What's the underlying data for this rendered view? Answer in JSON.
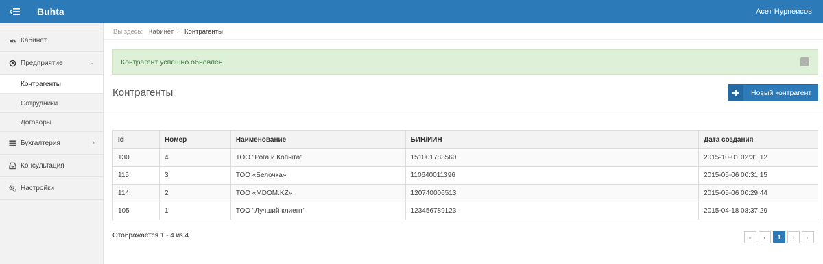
{
  "app": {
    "brand": "Buhta",
    "user": "Асет Нурпеисов"
  },
  "sidebar": {
    "items": [
      {
        "label": "Кабинет",
        "icon": "dashboard-icon"
      },
      {
        "label": "Предприятие",
        "icon": "circle-dot-icon",
        "chevron": "chevron-down-icon"
      },
      {
        "label": "Бухгалтерия",
        "icon": "list-icon",
        "chevron": "chevron-right-icon"
      },
      {
        "label": "Консультация",
        "icon": "inbox-icon"
      },
      {
        "label": "Настройки",
        "icon": "gears-icon"
      }
    ],
    "subitems": [
      {
        "label": "Контрагенты",
        "active": true
      },
      {
        "label": "Сотрудники"
      },
      {
        "label": "Договоры"
      }
    ]
  },
  "breadcrumb": {
    "here": "Вы здесь:",
    "home": "Кабинет",
    "separator": "›",
    "current": "Контрагенты"
  },
  "alert": {
    "message": "Контрагент успешно обновлен."
  },
  "page": {
    "title": "Контрагенты",
    "new_button": "Новый контрагент"
  },
  "table": {
    "columns": [
      "Id",
      "Номер",
      "Наименование",
      "БИН/ИИН",
      "Дата создания"
    ],
    "rows": [
      [
        "130",
        "4",
        "ТОО \"Рога и Копыта\"",
        "151001783560",
        "2015-10-01 02:31:12"
      ],
      [
        "115",
        "3",
        "ТОО «Белочка»",
        "110640011396",
        "2015-05-06 00:31:15"
      ],
      [
        "114",
        "2",
        "ТОО «MDOM.KZ»",
        "120740006513",
        "2015-05-06 00:29:44"
      ],
      [
        "105",
        "1",
        "ТОО \"Лучший клиент\"",
        "123456789123",
        "2015-04-18 08:37:29"
      ]
    ]
  },
  "info": "Отображается 1 - 4 из 4",
  "pagination": {
    "first": "«",
    "prev": "‹",
    "page": "1",
    "next": "›",
    "last": "»"
  },
  "colors": {
    "primary": "#2d7ab8",
    "alert_bg": "#dff0d8",
    "alert_text": "#3c763d",
    "sidebar_bg": "#f2f2f2"
  }
}
